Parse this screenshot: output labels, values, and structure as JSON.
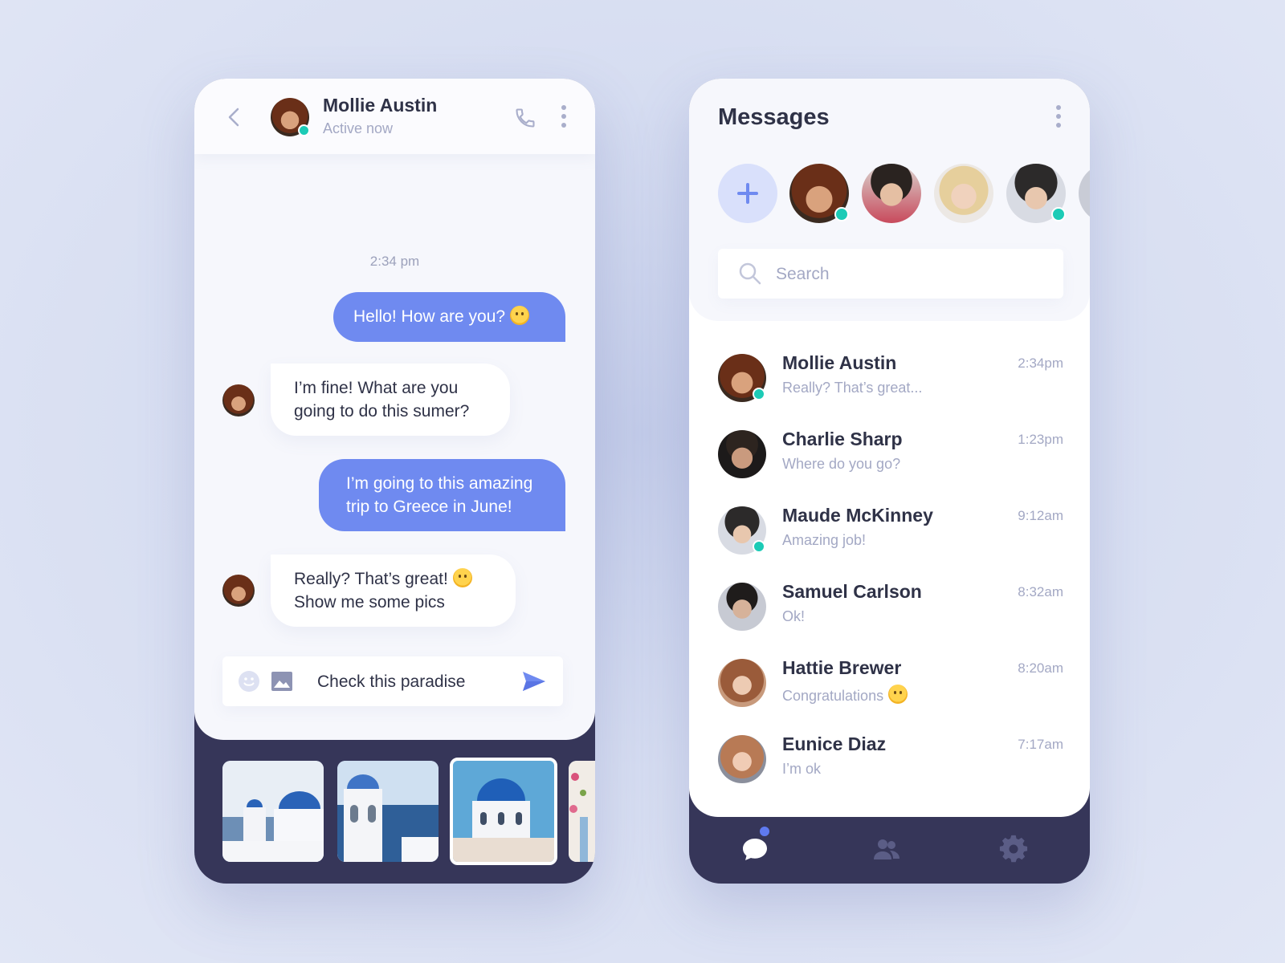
{
  "chat": {
    "contact_name": "Mollie Austin",
    "contact_status": "Active now",
    "timestamp": "2:34 pm",
    "messages": [
      {
        "direction": "out",
        "lines": [
          "Hello! How are you?"
        ],
        "emoji": "smiling-emoji"
      },
      {
        "direction": "in",
        "lines": [
          "I’m fine! What are you",
          "going to do this sumer?"
        ]
      },
      {
        "direction": "out",
        "lines": [
          "I’m going to this amazing",
          "trip to Greece in June!"
        ]
      },
      {
        "direction": "in",
        "lines": [
          "Really? That’s great!",
          "Show me some pics"
        ],
        "emoji": "winking-emoji"
      }
    ],
    "input_value": "Check this paradise",
    "thumbnails": [
      "santorini-churches-photo",
      "bell-tower-photo",
      "blue-dome-photo-selected",
      "flower-street-photo"
    ]
  },
  "messages": {
    "title": "Messages",
    "search_placeholder": "Search",
    "stories": [
      "Mollie Austin",
      "story-2",
      "story-3",
      "Maude McKinney",
      "story-5"
    ],
    "conversations": [
      {
        "name": "Mollie Austin",
        "preview": "Really? That’s great...",
        "time": "2:34pm",
        "online": true
      },
      {
        "name": "Charlie Sharp",
        "preview": "Where do you go?",
        "time": "1:23pm",
        "online": false
      },
      {
        "name": "Maude McKinney",
        "preview": "Amazing job!",
        "time": "9:12am",
        "online": true
      },
      {
        "name": "Samuel Carlson",
        "preview": "Ok!",
        "time": "8:32am",
        "online": false
      },
      {
        "name": "Hattie Brewer",
        "preview": "Congratulations",
        "time": "8:20am",
        "online": false,
        "emoji": "winking-emoji"
      },
      {
        "name": "Eunice Diaz",
        "preview": "I’m ok",
        "time": "7:17am",
        "online": false
      }
    ],
    "nav": [
      "chat-bubble-icon",
      "contacts-icon",
      "settings-gear-icon"
    ]
  },
  "colors": {
    "accent": "#6f8af0",
    "online": "#1ccbb6",
    "dark_panel": "#363659",
    "text_primary": "#2f3247",
    "text_muted": "#a3a8c4"
  }
}
